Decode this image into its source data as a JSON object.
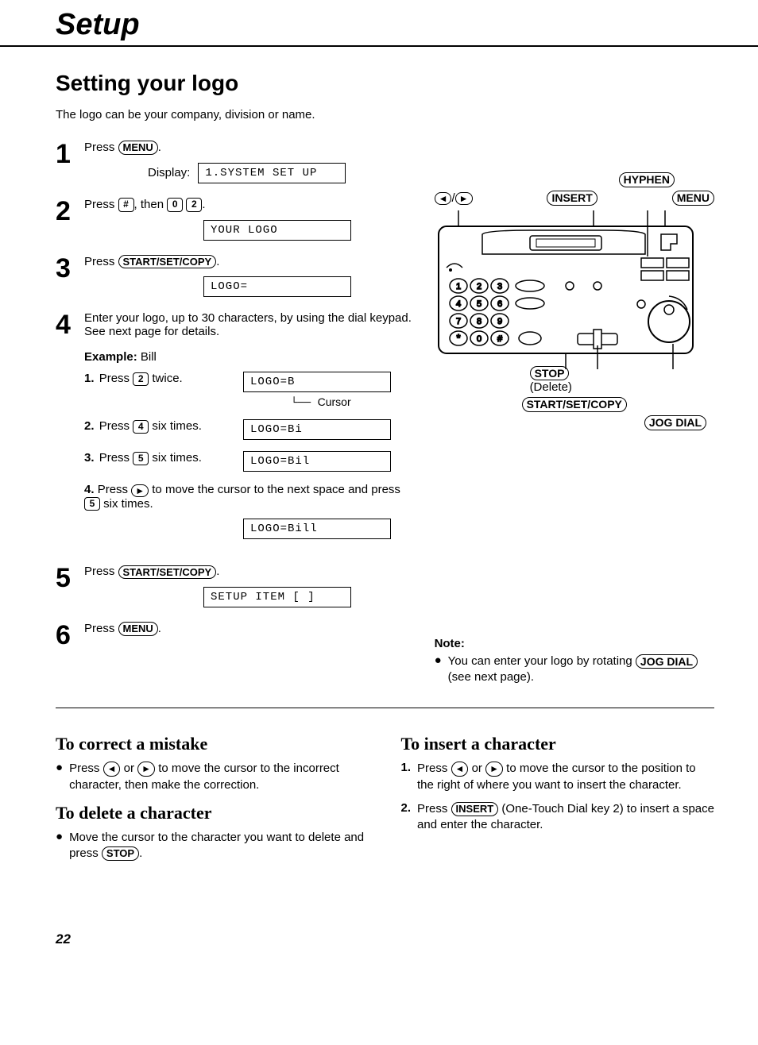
{
  "page": {
    "title": "Setup",
    "section_title": "Setting your logo",
    "intro": "The logo can be your company, division or name.",
    "page_number": "22"
  },
  "keys": {
    "menu": "MENU",
    "hash": "#",
    "zero": "0",
    "two": "2",
    "four": "4",
    "five": "5",
    "start_set_copy": "START/SET/COPY",
    "stop": "STOP",
    "insert": "INSERT",
    "hyphen": "HYPHEN",
    "jog_dial": "JOG DIAL",
    "left": "◄",
    "right": "►"
  },
  "display": {
    "label": "Display:",
    "d1": "1.SYSTEM SET UP",
    "d2": "YOUR LOGO",
    "d3": "LOGO=",
    "ex1": "LOGO=B",
    "ex2": "LOGO=Bi",
    "ex3": "LOGO=Bil",
    "ex4": "LOGO=Bill",
    "d5": "SETUP ITEM [  ]"
  },
  "steps": {
    "s1": {
      "num": "1",
      "text_a": "Press ",
      "text_b": "."
    },
    "s2": {
      "num": "2",
      "text_a": "Press ",
      "text_b": ", then ",
      "text_c": "."
    },
    "s3": {
      "num": "3",
      "text_a": "Press ",
      "text_b": "."
    },
    "s4": {
      "num": "4",
      "text": "Enter your logo, up to 30 characters, by using the dial keypad. See next page for details.",
      "example_label_a": "Example:",
      "example_label_b": "Bill",
      "ex1_num": "1.",
      "ex1_a": "Press ",
      "ex1_b": " twice.",
      "cursor_label": "Cursor",
      "ex2_num": "2.",
      "ex2_a": "Press ",
      "ex2_b": " six times.",
      "ex3_num": "3.",
      "ex3_a": "Press ",
      "ex3_b": " six times.",
      "ex4_num": "4.",
      "ex4_a": "Press ",
      "ex4_b": " to move the cursor to the next space and press ",
      "ex4_c": " six times."
    },
    "s5": {
      "num": "5",
      "text_a": "Press ",
      "text_b": "."
    },
    "s6": {
      "num": "6",
      "text_a": "Press ",
      "text_b": "."
    }
  },
  "diagram": {
    "slash": "/",
    "stop_sub": "(Delete)"
  },
  "note": {
    "head": "Note:",
    "text_a": "You can enter your logo by rotating ",
    "text_b": " (see next page)."
  },
  "correct": {
    "title": "To correct a mistake",
    "text_a": "Press ",
    "text_b": " or ",
    "text_c": " to move the cursor to the incorrect character, then make the correction."
  },
  "delete": {
    "title": "To delete a character",
    "text_a": "Move the cursor to the character you want to delete and press ",
    "text_b": "."
  },
  "insert": {
    "title": "To insert a character",
    "i1_num": "1.",
    "i1_a": "Press ",
    "i1_b": " or ",
    "i1_c": " to move the cursor to the position to the right of where you want to insert the character.",
    "i2_num": "2.",
    "i2_a": "Press ",
    "i2_b": " (One-Touch Dial key 2) to insert a space and enter the character."
  }
}
